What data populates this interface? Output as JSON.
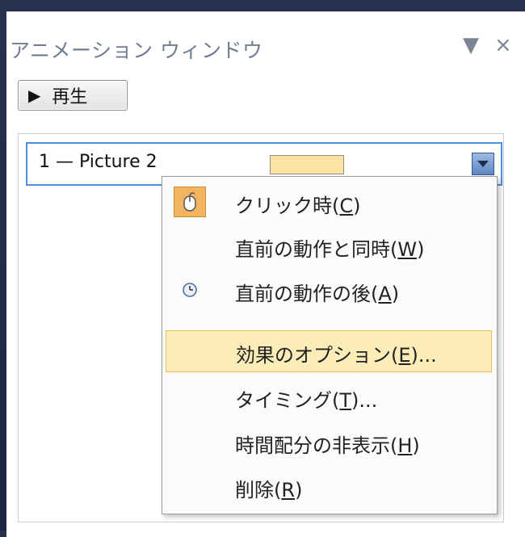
{
  "pane": {
    "title": "アニメーション ウィンドウ",
    "dropdown_glyph": "▼",
    "close_glyph": "×"
  },
  "play": {
    "icon": "▶",
    "label": "再生"
  },
  "animation_item": {
    "label": "1 — Picture 2",
    "bar_color": "#fde2a2"
  },
  "menu": {
    "items": [
      {
        "text": "クリック時(",
        "key": "C",
        "suffix": ")",
        "icon": "mouse-icon"
      },
      {
        "text": "直前の動作と同時(",
        "key": "W",
        "suffix": ")"
      },
      {
        "text": "直前の動作の後(",
        "key": "A",
        "suffix": ")",
        "icon": "clock-icon"
      },
      {
        "text": "効果のオプション(",
        "key": "E",
        "suffix": ")...",
        "highlighted": true
      },
      {
        "text": "タイミング(",
        "key": "T",
        "suffix": ")..."
      },
      {
        "text": "時間配分の非表示(",
        "key": "H",
        "suffix": ")"
      },
      {
        "text": "削除(",
        "key": "R",
        "suffix": ")"
      }
    ]
  }
}
